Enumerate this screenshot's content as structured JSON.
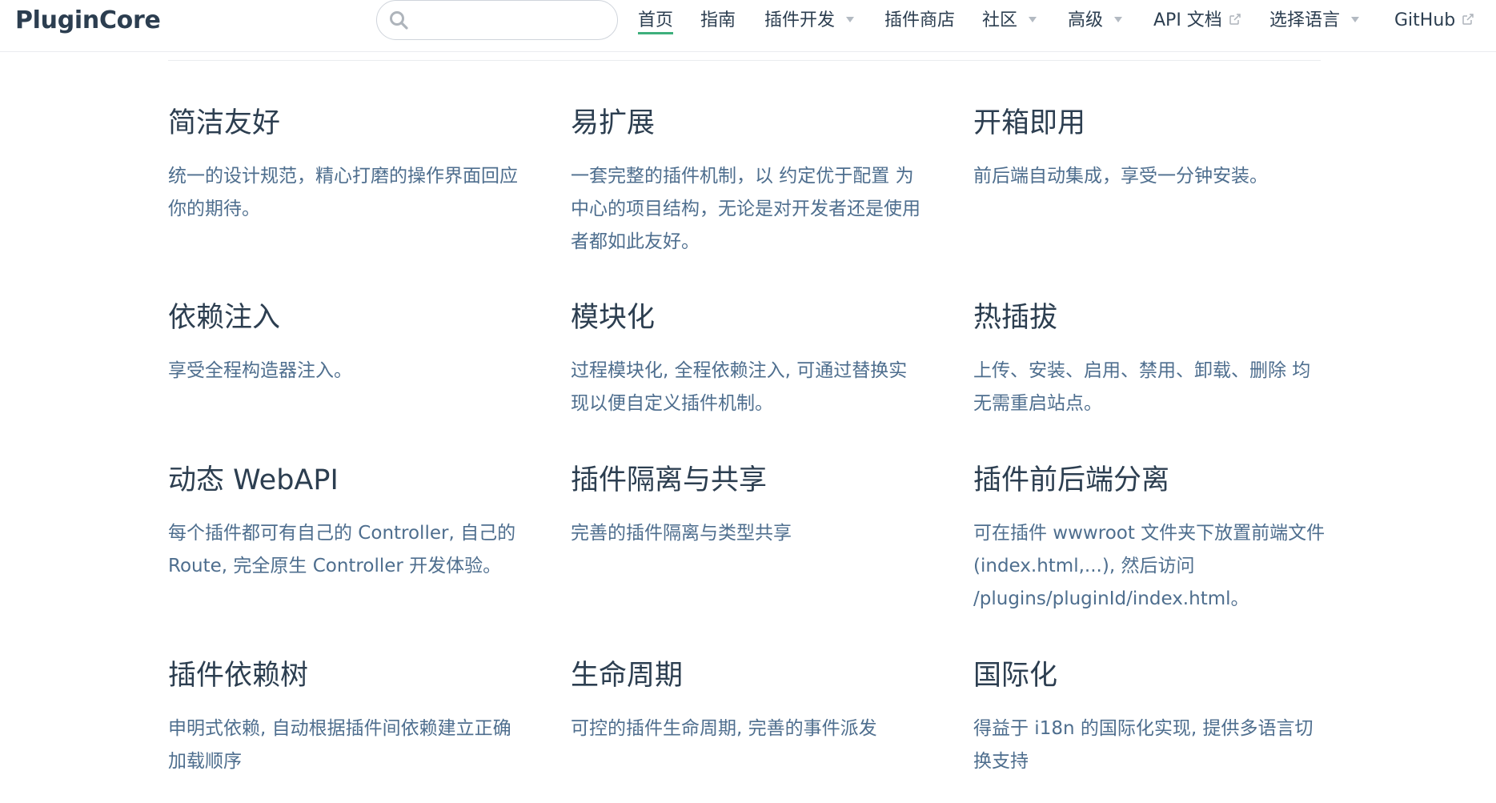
{
  "navbar": {
    "site_name": "PluginCore",
    "search": {
      "placeholder": "",
      "value": ""
    },
    "links": [
      {
        "label": "首页",
        "active": true,
        "dropdown": false,
        "external": false
      },
      {
        "label": "指南",
        "active": false,
        "dropdown": false,
        "external": false
      },
      {
        "label": "插件开发",
        "active": false,
        "dropdown": true,
        "external": false
      },
      {
        "label": "插件商店",
        "active": false,
        "dropdown": false,
        "external": false
      },
      {
        "label": "社区",
        "active": false,
        "dropdown": true,
        "external": false
      },
      {
        "label": "高级",
        "active": false,
        "dropdown": true,
        "external": false
      },
      {
        "label": "API 文档",
        "active": false,
        "dropdown": false,
        "external": true
      },
      {
        "label": "选择语言",
        "active": false,
        "dropdown": true,
        "external": false
      },
      {
        "label": "GitHub",
        "active": false,
        "dropdown": false,
        "external": true
      }
    ]
  },
  "features": [
    {
      "title": "简洁友好",
      "details": "统一的设计规范，精心打磨的操作界面回应你的期待。"
    },
    {
      "title": "易扩展",
      "details": "一套完整的插件机制，以 约定优于配置 为中心的项目结构，无论是对开发者还是使用者都如此友好。"
    },
    {
      "title": "开箱即用",
      "details": "前后端自动集成，享受一分钟安装。"
    },
    {
      "title": "依赖注入",
      "details": "享受全程构造器注入。"
    },
    {
      "title": "模块化",
      "details": "过程模块化, 全程依赖注入, 可通过替换实现以便自定义插件机制。"
    },
    {
      "title": "热插拔",
      "details": "上传、安装、启用、禁用、卸载、删除 均无需重启站点。"
    },
    {
      "title": "动态 WebAPI",
      "details": "每个插件都可有自己的 Controller, 自己的 Route, 完全原生 Controller 开发体验。"
    },
    {
      "title": "插件隔离与共享",
      "details": "完善的插件隔离与类型共享"
    },
    {
      "title": "插件前后端分离",
      "details": "可在插件 wwwroot 文件夹下放置前端文件 (index.html,...), 然后访问 /plugins/pluginId/index.html。"
    },
    {
      "title": "插件依赖树",
      "details": "申明式依赖, 自动根据插件间依赖建立正确加载顺序"
    },
    {
      "title": "生命周期",
      "details": "可控的插件生命周期, 完善的事件派发"
    },
    {
      "title": "国际化",
      "details": "得益于 i18n 的国际化实现, 提供多语言切换支持"
    }
  ],
  "colors": {
    "accent": "#3eaf7c",
    "text": "#2c3e50",
    "muted_text": "#4e6e8e",
    "border": "#eaecef"
  }
}
